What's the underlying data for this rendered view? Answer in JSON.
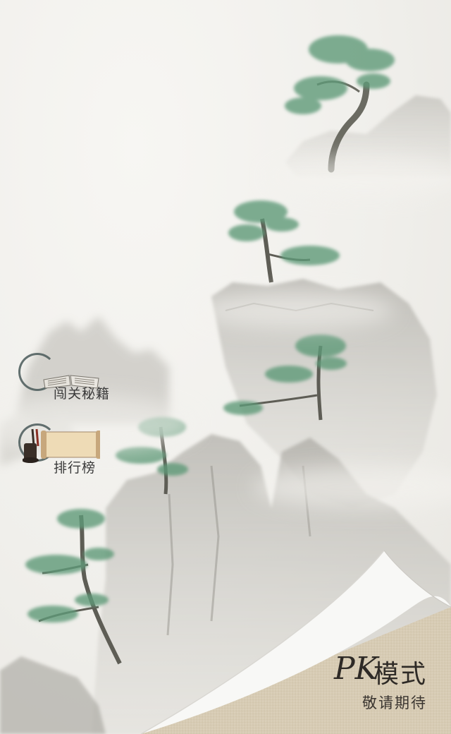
{
  "menu": {
    "items": [
      {
        "label": "闯关秘籍",
        "icon": "open-book-icon"
      },
      {
        "label": "排行榜",
        "icon": "scroll-icon"
      }
    ]
  },
  "pk_mode": {
    "mark": "PK",
    "title": "模式",
    "subtitle": "敬请期待"
  },
  "colors": {
    "paper": "#efeeea",
    "ink": "#2e2a26",
    "pine": "#5f9a78",
    "linen": "#d8ccb4"
  }
}
